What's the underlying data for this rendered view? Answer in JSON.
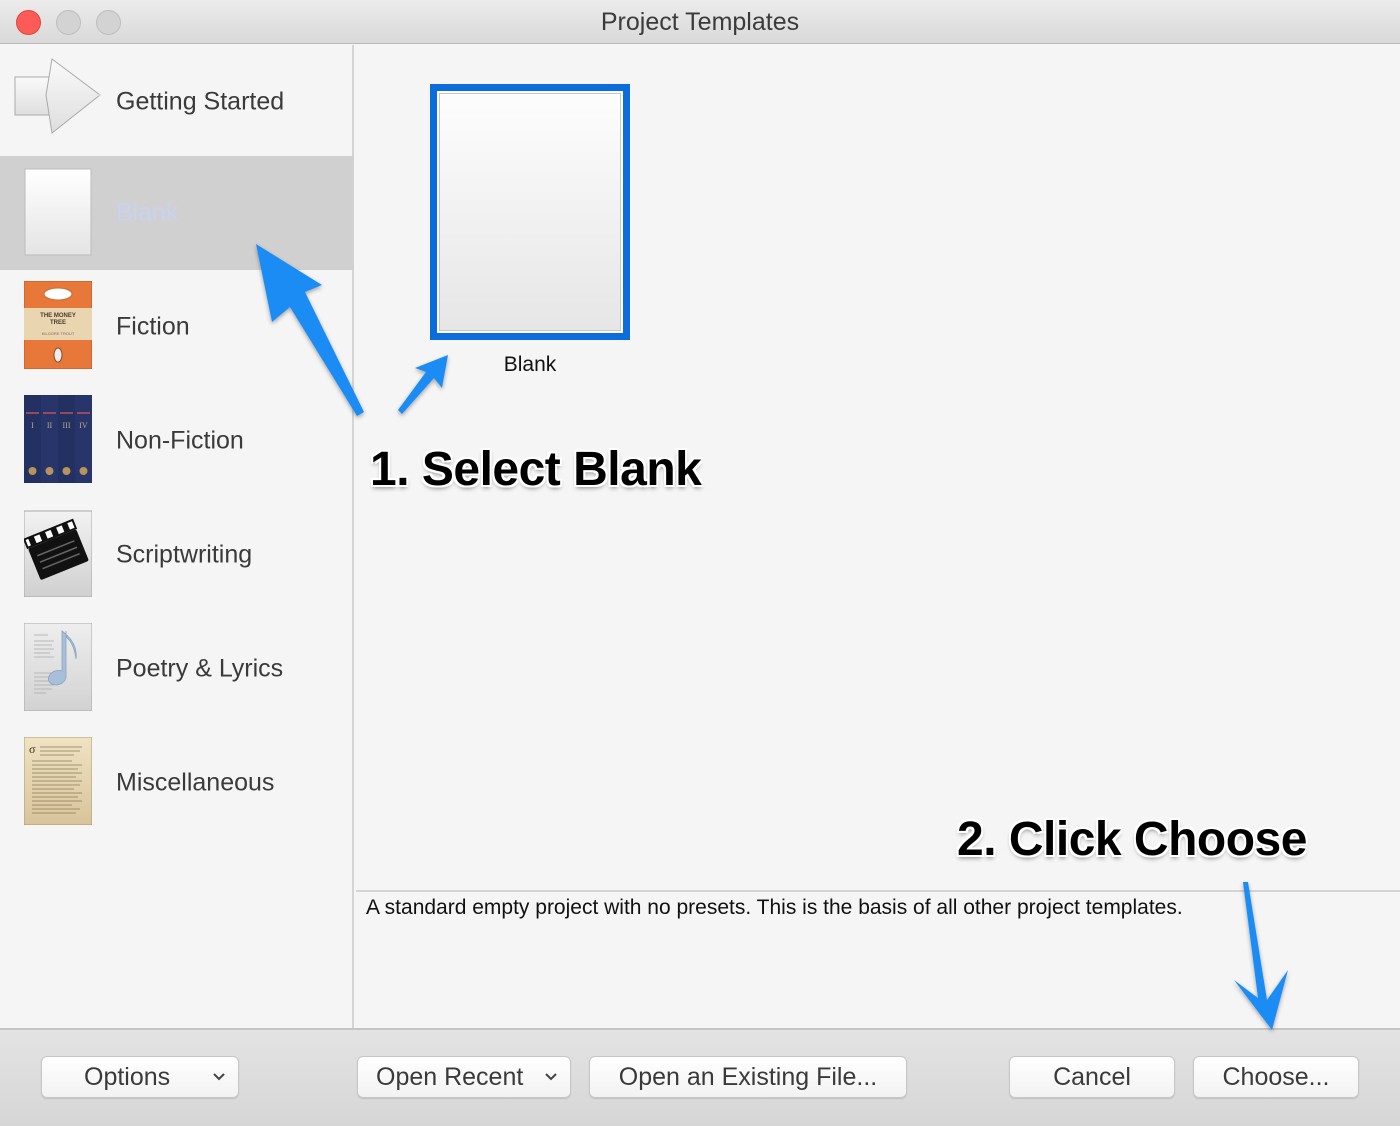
{
  "window": {
    "title": "Project Templates",
    "traffic_lights": [
      "close",
      "minimize",
      "zoom"
    ]
  },
  "sidebar": {
    "selected_index": 1,
    "items": [
      {
        "label": "Getting Started",
        "icon": "arrow-right-icon"
      },
      {
        "label": "Blank",
        "icon": "blank-page-icon"
      },
      {
        "label": "Fiction",
        "icon": "fiction-book-icon",
        "icon_text": [
          "THE MONEY",
          "TREE",
          "KILGORE TROUT"
        ]
      },
      {
        "label": "Non-Fiction",
        "icon": "encyclopedia-volumes-icon",
        "icon_text": [
          "I",
          "II",
          "III",
          "IV"
        ]
      },
      {
        "label": "Scriptwriting",
        "icon": "clapperboard-icon"
      },
      {
        "label": "Poetry & Lyrics",
        "icon": "music-note-page-icon"
      },
      {
        "label": "Miscellaneous",
        "icon": "parchment-page-icon"
      }
    ]
  },
  "main": {
    "templates": [
      {
        "label": "Blank",
        "selected": true
      }
    ],
    "description": "A standard empty project with no presets. This is the basis of all other project templates."
  },
  "bottom_bar": {
    "options_label": "Options",
    "open_recent_label": "Open Recent",
    "open_existing_label": "Open an Existing File...",
    "cancel_label": "Cancel",
    "choose_label": "Choose..."
  },
  "annotations": {
    "step1": "1. Select Blank",
    "step2": "2. Click Choose",
    "arrow_color": "#1e8cf5"
  },
  "colors": {
    "selection_border": "#0b6cdc",
    "sidebar_selected_bg": "#d0d0d0",
    "close_button": "#fc5b57"
  }
}
